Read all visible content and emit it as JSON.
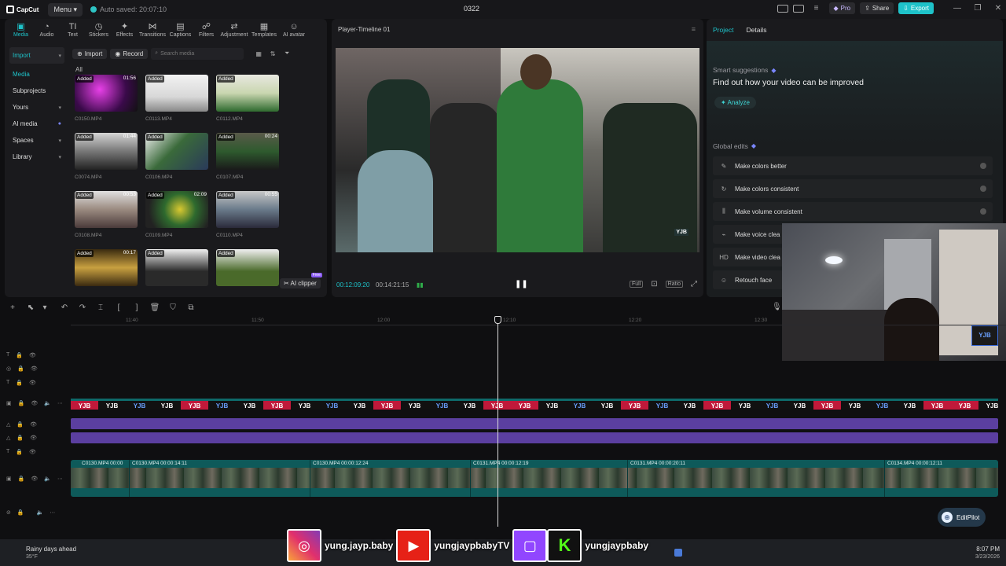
{
  "app": {
    "logo": "CapCut",
    "menu_label": "Menu",
    "autosave": "Auto saved: 20:07:10",
    "project_title": "0322",
    "pro_label": "Pro",
    "share_label": "Share",
    "export_label": "Export"
  },
  "tool_tabs": [
    {
      "label": "Media",
      "icon": "media-icon"
    },
    {
      "label": "Audio",
      "icon": "audio-icon"
    },
    {
      "label": "Text",
      "icon": "text-icon"
    },
    {
      "label": "Stickers",
      "icon": "stickers-icon"
    },
    {
      "label": "Effects",
      "icon": "effects-icon"
    },
    {
      "label": "Transitions",
      "icon": "transitions-icon"
    },
    {
      "label": "Captions",
      "icon": "captions-icon"
    },
    {
      "label": "Filters",
      "icon": "filters-icon"
    },
    {
      "label": "Adjustment",
      "icon": "adjustment-icon"
    },
    {
      "label": "Templates",
      "icon": "templates-icon"
    },
    {
      "label": "AI avatar",
      "icon": "ai-avatar-icon"
    }
  ],
  "side_nav": [
    {
      "label": "Import"
    },
    {
      "label": "Media"
    },
    {
      "label": "Subprojects"
    },
    {
      "label": "Yours"
    },
    {
      "label": "AI media"
    },
    {
      "label": "Spaces"
    },
    {
      "label": "Library"
    }
  ],
  "media_toolbar": {
    "import_label": "Import",
    "record_label": "Record",
    "search_placeholder": "Search media"
  },
  "all_label": "All",
  "clips": [
    {
      "name": "C0150.MP4",
      "badge": "Added",
      "duration": "01:56"
    },
    {
      "name": "C0113.MP4",
      "badge": "Added",
      "duration": ""
    },
    {
      "name": "C0112.MP4",
      "badge": "Added",
      "duration": ""
    },
    {
      "name": "C0074.MP4",
      "badge": "Added",
      "duration": "01:44"
    },
    {
      "name": "C0106.MP4",
      "badge": "Added",
      "duration": ""
    },
    {
      "name": "C0107.MP4",
      "badge": "Added",
      "duration": "00:24"
    },
    {
      "name": "C0108.MP4",
      "badge": "Added",
      "duration": "00:53"
    },
    {
      "name": "C0109.MP4",
      "badge": "Added",
      "duration": "02:09"
    },
    {
      "name": "C0110.MP4",
      "badge": "Added",
      "duration": "00:55"
    },
    {
      "name": "",
      "badge": "Added",
      "duration": "00:17"
    },
    {
      "name": "",
      "badge": "Added",
      "duration": ""
    },
    {
      "name": "",
      "badge": "Added",
      "duration": ""
    }
  ],
  "ai_clipper": {
    "label": "AI clipper",
    "tag": "Free"
  },
  "player": {
    "title": "Player-Timeline 01",
    "current_time": "00:12:09:20",
    "total_time": "00:14:21:15",
    "full_label": "Full",
    "ratio_label": "Ratio",
    "video_logo": "YJB"
  },
  "right_panel": {
    "tabs": [
      "Project",
      "Details"
    ],
    "smart_title": "Smart suggestions",
    "smart_subtitle": "Find out how your video can be improved",
    "analyze_label": "Analyze",
    "global_title": "Global edits",
    "global_items": [
      {
        "label": "Make colors better",
        "icon": "magic-wand-icon"
      },
      {
        "label": "Make colors consistent",
        "icon": "color-sync-icon"
      },
      {
        "label": "Make volume consistent",
        "icon": "equalizer-icon"
      },
      {
        "label": "Make voice clea",
        "icon": "voice-icon"
      },
      {
        "label": "Make video clea",
        "icon": "hd-icon"
      },
      {
        "label": "Retouch face",
        "icon": "retouch-icon"
      }
    ]
  },
  "webcam": {
    "logo": "YJB"
  },
  "timeline": {
    "ruler_ticks": [
      "11:40",
      "11:50",
      "12:00",
      "12:10",
      "12:20",
      "12:30"
    ],
    "yjb_pattern": [
      "r",
      "w",
      "b",
      "w",
      "r",
      "b",
      "w",
      "r",
      "w",
      "b",
      "w",
      "r",
      "w",
      "b",
      "w",
      "r"
    ],
    "yjb_text": "YJB",
    "segments": [
      {
        "label": "C0130.MP4  00:00"
      },
      {
        "label": "C0130.MP4  00:00:14:11"
      },
      {
        "label": "C0130.MP4  00:00:12:24"
      },
      {
        "label": "C0131.MP4  00:00:12:19"
      },
      {
        "label": "C0131.MP4  00:00:20:11"
      },
      {
        "label": "C0134.MP4  00:00:12:11"
      }
    ]
  },
  "editpilot_label": "EditPilot",
  "taskbar": {
    "weather_title": "Rainy days ahead",
    "weather_temp": "35°F",
    "time": "8:07 PM",
    "date": "3/23/2026"
  },
  "social": {
    "instagram": "yung.jayp.baby",
    "youtube": "yungjaypbabyTV",
    "twitch_kick": "yungjaypbaby"
  }
}
